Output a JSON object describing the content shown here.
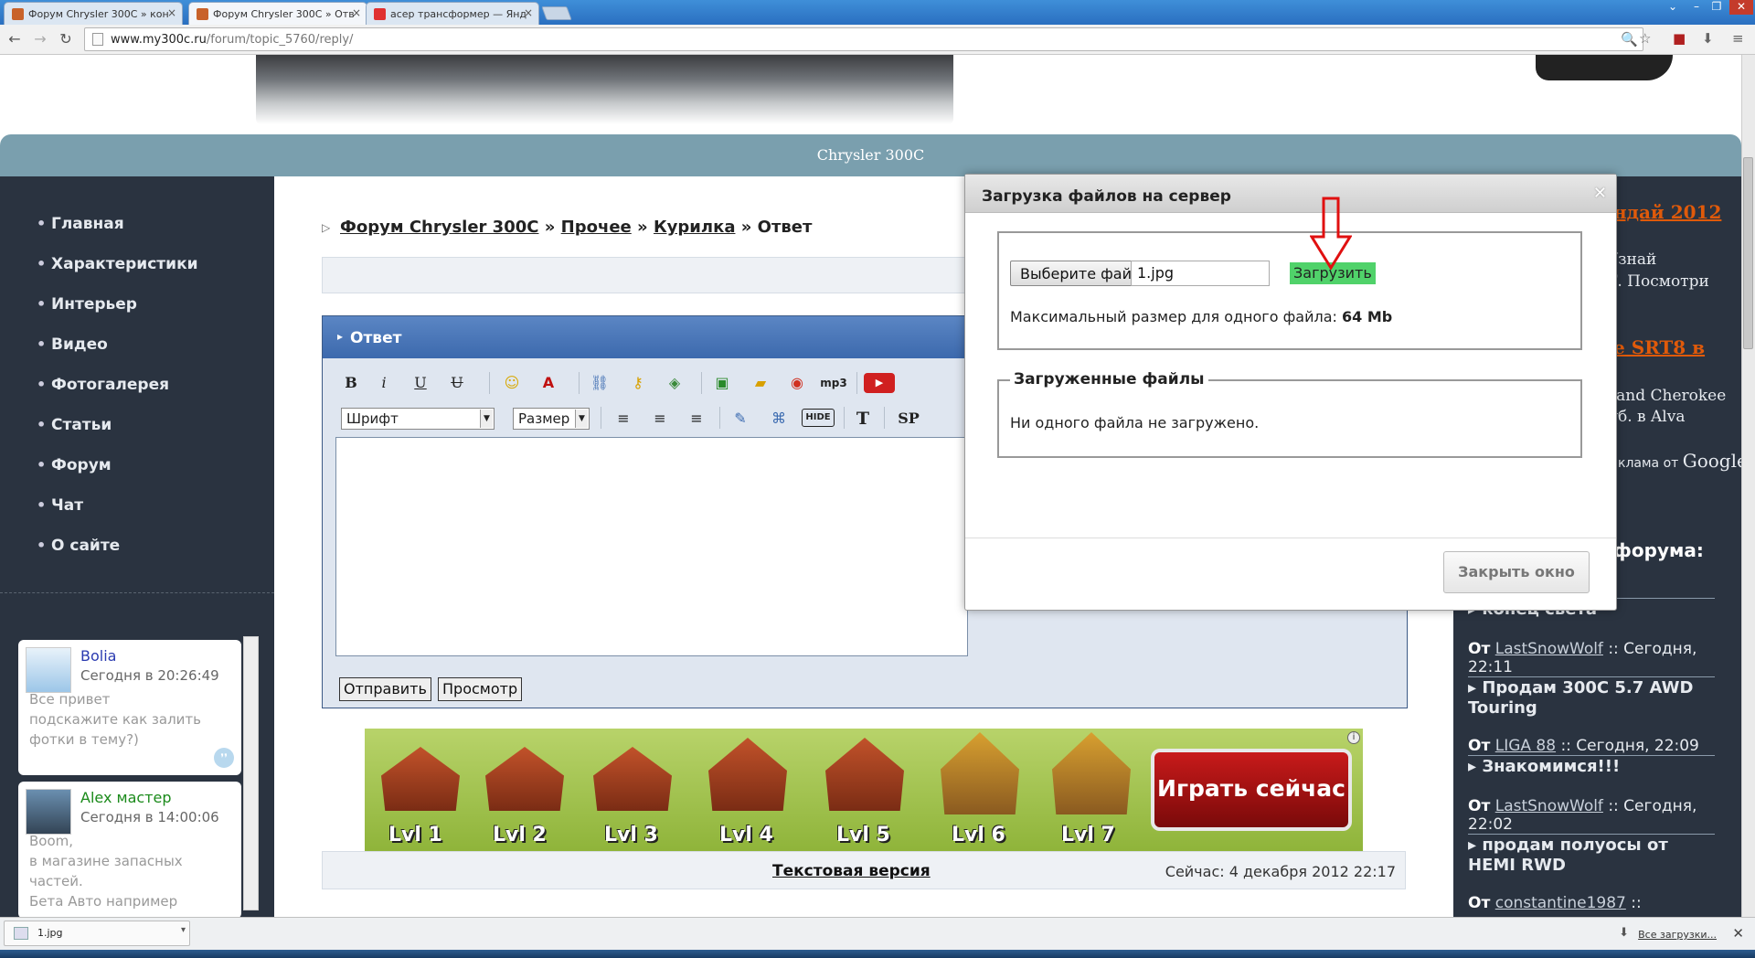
{
  "browser": {
    "tabs": [
      {
        "label": "Форум Chrysler 300C » кон",
        "favicon_color": "#c8622a"
      },
      {
        "label": "Форум Chrysler 300C » Отв",
        "favicon_color": "#c8622a"
      },
      {
        "label": "асер трансформер — Янд",
        "favicon_color": "#e03030"
      }
    ],
    "url_host": "www.my300c.ru",
    "url_path": "/forum/topic_5760/reply/"
  },
  "site": {
    "bar_title": "Chrysler 300C",
    "nav": [
      "Главная",
      "Характеристики",
      "Интерьер",
      "Видео",
      "Фотогалерея",
      "Статьи",
      "Форум",
      "Чат",
      "О сайте"
    ]
  },
  "chat": [
    {
      "name": "Bolia",
      "name_color": "#2a3ab0",
      "time": "Сегодня в 20:26:49",
      "lines": [
        "Все привет",
        "подскажите как залить",
        "фотки в тему?)"
      ]
    },
    {
      "name": "Alex мастер",
      "name_color": "#1a8a1a",
      "time": "Сегодня в 14:00:06",
      "lines": [
        "Boom,",
        "в магазине запасных",
        "частей.",
        "Бета Авто например"
      ]
    }
  ],
  "breadcrumb": {
    "forum": "Форум Chrysler 300C",
    "sep": "»",
    "section": "Прочее",
    "topic": "Курилка",
    "current": "Ответ"
  },
  "reply": {
    "header": "Ответ",
    "font_select": "Шрифт",
    "size_select": "Размер",
    "tool_labels": {
      "bold": "B",
      "italic": "i",
      "underline": "U",
      "strike": "U",
      "mp3": "mp3",
      "hide": "HIDE",
      "text": "T",
      "sp": "SP"
    },
    "send_button": "Отправить",
    "preview_button": "Просмотр"
  },
  "banner": {
    "levels": [
      "Lvl 1",
      "Lvl 2",
      "Lvl 3",
      "Lvl 4",
      "Lvl 5",
      "Lvl 6",
      "Lvl 7"
    ],
    "play_label": "Играть сейчас"
  },
  "footer": {
    "text_version": "Текстовая версия",
    "now": "Сейчас: 4 декабря 2012 22:17"
  },
  "right": {
    "ad1_title": "ндай 2012",
    "ad1_lines": [
      "Узнай",
      "Т. Посмотри"
    ],
    "ad2_title": "е SRT8 в",
    "ad2_lines": [
      "rand Cherokee",
      "уб. в Alva"
    ],
    "ads_by": "клама от",
    "google": "Google",
    "forum_title": "ы форума:",
    "topics": [
      {
        "title": "конец света"
      },
      {
        "from": "От",
        "user": "LastSnowWolf",
        "time": ":: Сегодня,",
        "time2": "22:11",
        "title": "Продам 300С 5.7 AWD",
        "title2": "Touring"
      },
      {
        "from": "От",
        "user": "LIGA 88",
        "time": ":: Сегодня, 22:09",
        "title": "Знакомимся!!!"
      },
      {
        "from": "От",
        "user": "LastSnowWolf",
        "time": ":: Сегодня,",
        "time2": "22:02",
        "title": "продам полуосы от",
        "title2": "HEMI RWD"
      },
      {
        "from": "От",
        "user": "constantine1987",
        "time": "::"
      }
    ]
  },
  "modal": {
    "title": "Загрузка файлов на сервер",
    "close_glyph": "✕",
    "choose_button": "Выберите файл",
    "file_name": "1.jpg",
    "upload_button": "Загрузить",
    "max_size_label": "Максимальный размер для одного файла:",
    "max_size_value": "64 Mb",
    "uploaded_legend": "Загруженные файлы",
    "no_files": "Ни одного файла не загружено.",
    "close_window": "Закрыть окно"
  },
  "downloads": {
    "file": "1.jpg",
    "all": "Все загрузки..."
  },
  "colors": {
    "accent_green": "#50d26a",
    "arrow_red": "#e01010",
    "nav_bg": "#2a3340",
    "bar_bg": "#7a9fae"
  }
}
